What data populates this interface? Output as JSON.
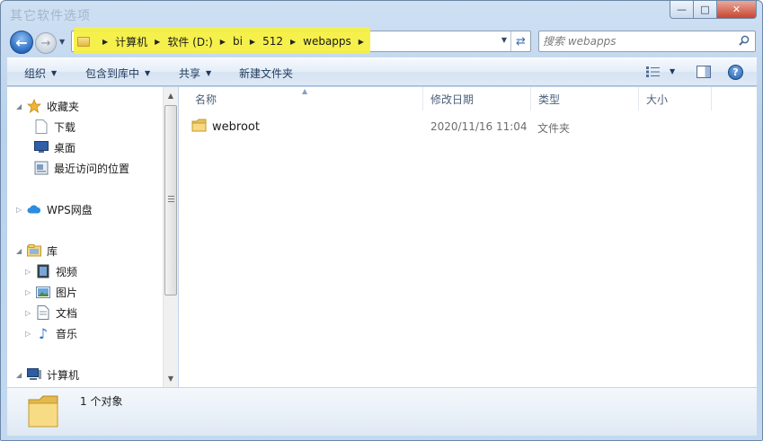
{
  "window": {
    "title": "其它软件选项",
    "controls": {
      "minimize": "—",
      "maximize": "□",
      "close": "✕"
    }
  },
  "address": {
    "breadcrumbs": [
      "计算机",
      "软件 (D:)",
      "bi",
      "512",
      "webapps"
    ]
  },
  "search": {
    "placeholder": "搜索 webapps"
  },
  "toolbar": {
    "organize": "组织",
    "include_in_library": "包含到库中",
    "share": "共享",
    "new_folder": "新建文件夹",
    "help": "?"
  },
  "nav": {
    "favorites": {
      "label": "收藏夹",
      "items": [
        "下载",
        "桌面",
        "最近访问的位置"
      ]
    },
    "wps": {
      "label": "WPS网盘"
    },
    "libraries": {
      "label": "库",
      "items": [
        "视频",
        "图片",
        "文档",
        "音乐"
      ]
    },
    "computer": {
      "label": "计算机"
    }
  },
  "columns": {
    "name": "名称",
    "modified": "修改日期",
    "type": "类型",
    "size": "大小"
  },
  "files": [
    {
      "name": "webroot",
      "modified": "2020/11/16 11:04",
      "type": "文件夹",
      "size": ""
    }
  ],
  "status": {
    "count_text": "1 个对象"
  },
  "colors": {
    "highlight": "#f4ef42",
    "accent": "#1f5ea8"
  }
}
